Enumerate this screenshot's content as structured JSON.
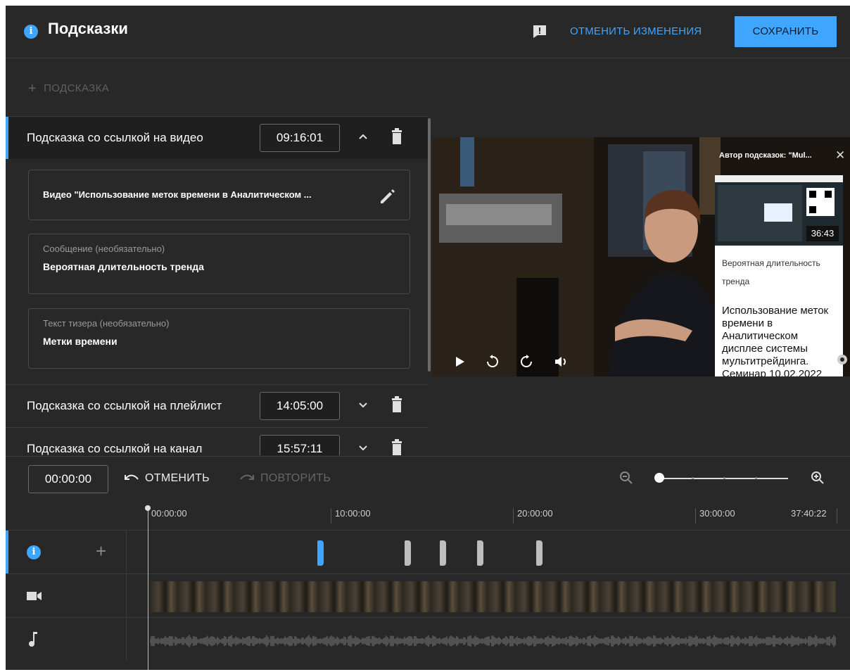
{
  "header": {
    "title": "Подсказки",
    "discard_label": "ОТМЕНИТЬ ИЗМЕНЕНИЯ",
    "save_label": "СОХРАНИТЬ"
  },
  "left_panel": {
    "add_label": "ПОДСКАЗКА",
    "cards": [
      {
        "title": "Подсказка со ссылкой на видео",
        "time": "09:16:01",
        "expanded": true,
        "video_value": "Видео \"Использование меток времени в Аналитическом ...",
        "message_label": "Сообщение (необязательно)",
        "message_value": "Вероятная длительность тренда",
        "teaser_label": "Текст тизера (необязательно)",
        "teaser_value": "Метки времени"
      },
      {
        "title": "Подсказка со ссылкой на плейлист",
        "time": "14:05:00",
        "expanded": false
      },
      {
        "title": "Подсказка со ссылкой на канал",
        "time": "15:57:11",
        "expanded": false
      }
    ]
  },
  "preview": {
    "card_author": "Автор подсказок: \"Mul...",
    "thumb_duration": "36:43",
    "card_message": "Вероятная длительность тренда",
    "card_video_title": "Использование меток времени в Аналитическом дисплее системы мультитрейдинга. Семинар 10.02.2022"
  },
  "timeline": {
    "current_time": "00:00:00",
    "undo_label": "ОТМЕНИТЬ",
    "redo_label": "ПОВТОРИТЬ",
    "ticks": [
      "00:00:00",
      "10:00:00",
      "20:00:00",
      "30:00:00",
      "37:40:22"
    ],
    "card_markers": [
      {
        "time": "09:16:01",
        "active": true
      },
      {
        "time": "14:05:00",
        "active": false
      },
      {
        "time": "15:57:11",
        "active": false
      },
      {
        "time": "18:00:00",
        "active": false
      },
      {
        "time": "21:00:00",
        "active": false
      }
    ]
  },
  "colors": {
    "accent": "#3ea6ff",
    "background": "#282828",
    "panel_dark": "#1f1f1f"
  }
}
